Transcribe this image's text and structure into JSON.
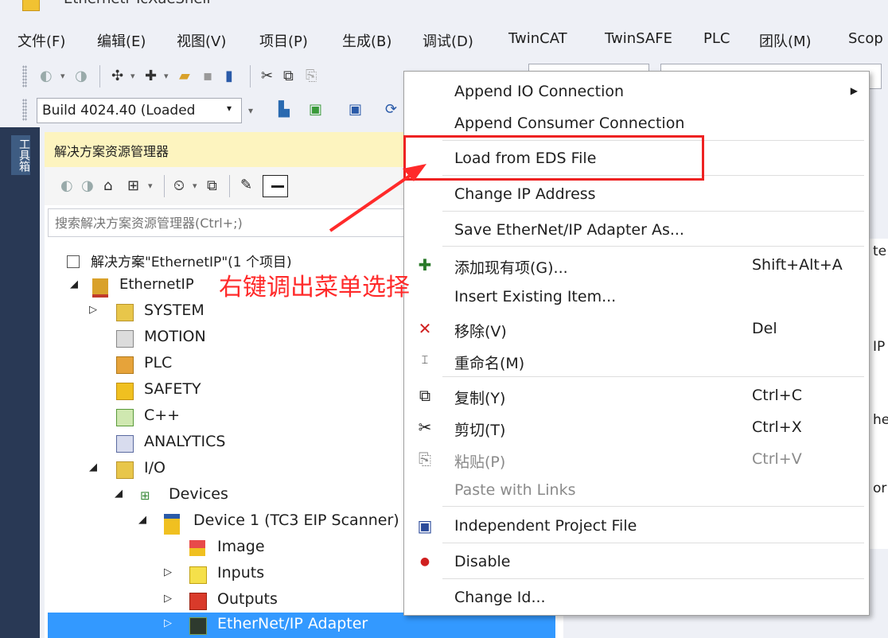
{
  "window": {
    "title": "Ethernetl  TcXaeShell"
  },
  "menubar": {
    "items": [
      "文件(F)",
      "编辑(E)",
      "视图(V)",
      "项目(P)",
      "生成(B)",
      "调试(D)",
      "TwinCAT",
      "TwinSAFE",
      "PLC",
      "团队(M)",
      "Scop"
    ]
  },
  "toolbar2": {
    "build_combo": "Build 4024.40 (Loaded"
  },
  "toolstrip": {
    "tab": "工具箱"
  },
  "explorer": {
    "title": "解决方案资源管理器",
    "search_placeholder": "搜索解决方案资源管理器(Ctrl+;)",
    "tree": [
      {
        "label": "解决方案\"EthernetIP\"(1 个项目)",
        "level": 0
      },
      {
        "label": "EthernetIP",
        "level": 0
      },
      {
        "label": "SYSTEM",
        "level": 1
      },
      {
        "label": "MOTION",
        "level": 1
      },
      {
        "label": "PLC",
        "level": 1
      },
      {
        "label": "SAFETY",
        "level": 1
      },
      {
        "label": "C++",
        "level": 1
      },
      {
        "label": "ANALYTICS",
        "level": 1
      },
      {
        "label": "I/O",
        "level": 1
      },
      {
        "label": "Devices",
        "level": 2
      },
      {
        "label": "Device 1 (TC3 EIP Scanner)",
        "level": 3
      },
      {
        "label": "Image",
        "level": 4
      },
      {
        "label": "Inputs",
        "level": 4
      },
      {
        "label": "Outputs",
        "level": 4
      },
      {
        "label": "EtherNet/IP Adapter",
        "level": 4,
        "selected": true
      }
    ]
  },
  "context_menu": {
    "items": [
      {
        "label": "Append IO Connection",
        "shortcut": "",
        "submenu": true
      },
      {
        "label": "Append Consumer Connection",
        "shortcut": ""
      },
      {
        "label": "Load from EDS File",
        "shortcut": ""
      },
      {
        "label": "Change IP Address",
        "shortcut": ""
      },
      {
        "label": "Save EtherNet/IP Adapter As...",
        "shortcut": ""
      },
      {
        "label": "添加现有项(G)...",
        "shortcut": "Shift+Alt+A",
        "icon": "add-existing-icon"
      },
      {
        "label": "Insert Existing Item...",
        "shortcut": ""
      },
      {
        "label": "移除(V)",
        "shortcut": "Del",
        "icon": "remove-icon"
      },
      {
        "label": "重命名(M)",
        "shortcut": "",
        "icon": "rename-icon"
      },
      {
        "label": "复制(Y)",
        "shortcut": "Ctrl+C",
        "icon": "copy-icon"
      },
      {
        "label": "剪切(T)",
        "shortcut": "Ctrl+X",
        "icon": "cut-icon"
      },
      {
        "label": "粘贴(P)",
        "shortcut": "Ctrl+V",
        "icon": "paste-icon",
        "disabled": true
      },
      {
        "label": "Paste with Links",
        "shortcut": "",
        "disabled": true
      },
      {
        "label": "Independent Project File",
        "shortcut": "",
        "icon": "save-icon"
      },
      {
        "label": "Disable",
        "shortcut": "",
        "icon": "disable-icon"
      },
      {
        "label": "Change Id...",
        "shortcut": ""
      }
    ]
  },
  "annotation": {
    "text": "右键调出菜单选择",
    "color": "#ff2a2a"
  },
  "right_edge_texts": [
    "te",
    "IP",
    "he",
    "or"
  ],
  "colors": {
    "selection": "#3399ff",
    "explorer_header": "#fdf4bf",
    "annotation_red": "#ee2222"
  }
}
